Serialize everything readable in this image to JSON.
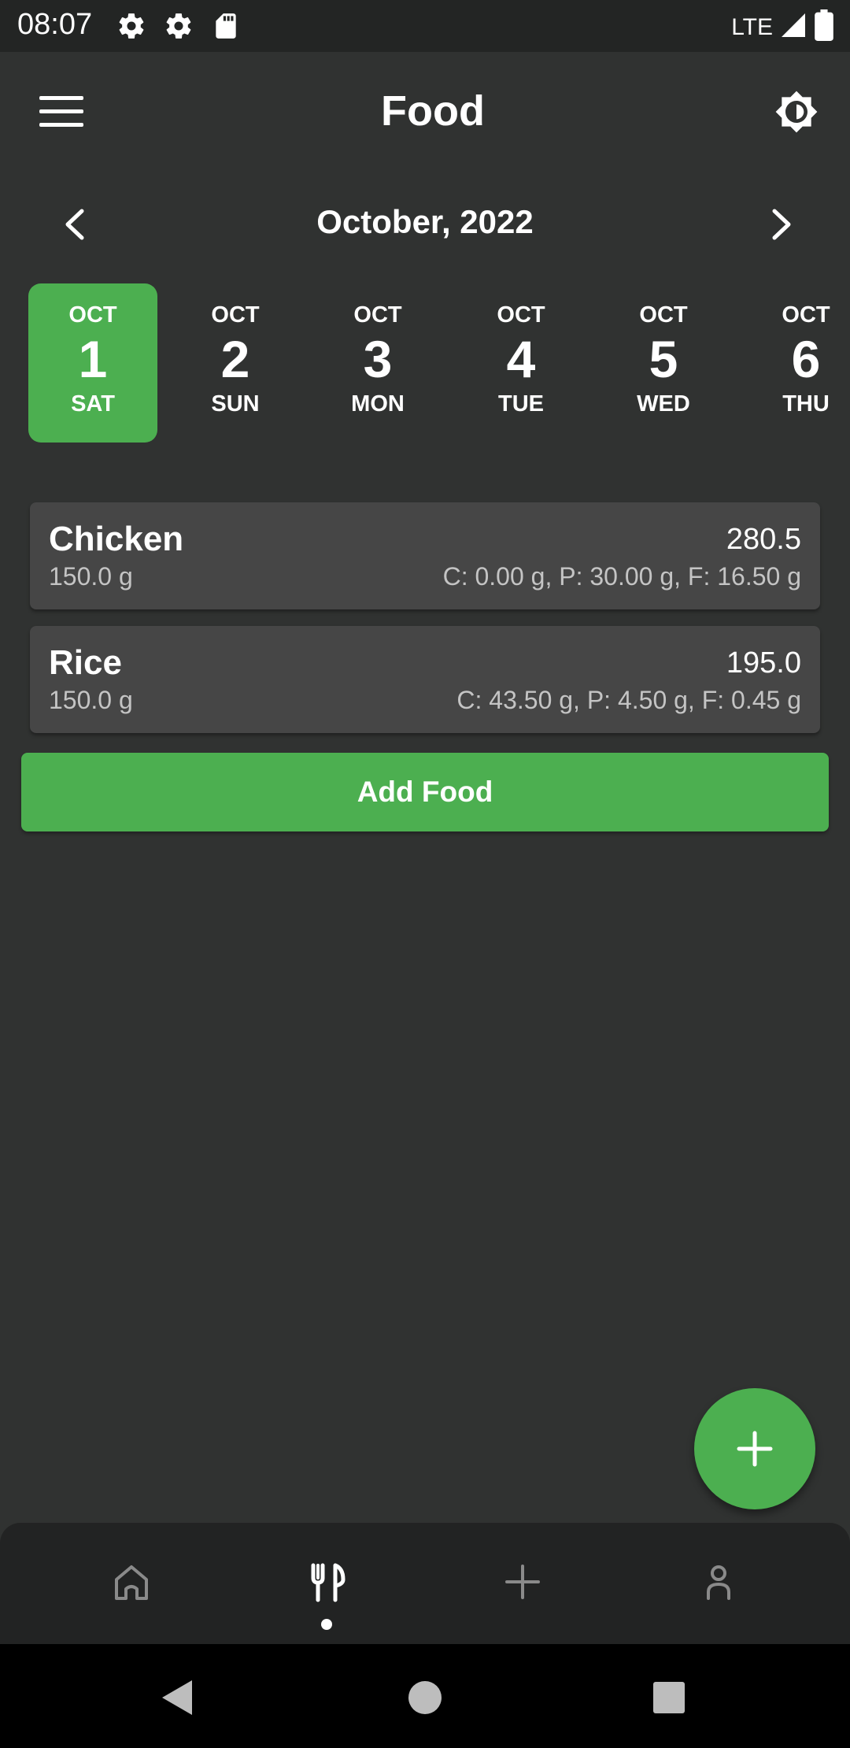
{
  "status_bar": {
    "time": "08:07",
    "network": "LTE",
    "icons": [
      "gear-icon",
      "gear-icon",
      "sd-card-icon",
      "signal-icon",
      "battery-icon"
    ]
  },
  "app_bar": {
    "title": "Food",
    "menu_icon": "hamburger-menu-icon",
    "settings_icon": "settings-brightness-icon"
  },
  "calendar": {
    "month_label": "October, 2022",
    "days": [
      {
        "month": "OCT",
        "day": "1",
        "weekday": "SAT",
        "selected": true
      },
      {
        "month": "OCT",
        "day": "2",
        "weekday": "SUN",
        "selected": false
      },
      {
        "month": "OCT",
        "day": "3",
        "weekday": "MON",
        "selected": false
      },
      {
        "month": "OCT",
        "day": "4",
        "weekday": "TUE",
        "selected": false
      },
      {
        "month": "OCT",
        "day": "5",
        "weekday": "WED",
        "selected": false
      },
      {
        "month": "OCT",
        "day": "6",
        "weekday": "THU",
        "selected": false
      }
    ]
  },
  "foods": [
    {
      "name": "Chicken",
      "weight": "150.0 g",
      "calories": "280.5",
      "macros": "C: 0.00 g, P: 30.00 g, F: 16.50 g"
    },
    {
      "name": "Rice",
      "weight": "150.0 g",
      "calories": "195.0",
      "macros": "C: 43.50 g, P: 4.50 g, F: 0.45 g"
    }
  ],
  "add_food_label": "Add Food",
  "fab_icon": "plus-icon",
  "bottom_nav": {
    "items": [
      {
        "icon": "home-icon",
        "active": false
      },
      {
        "icon": "fork-knife-icon",
        "active": true
      },
      {
        "icon": "plus-icon",
        "active": false
      },
      {
        "icon": "person-icon",
        "active": false
      }
    ]
  },
  "colors": {
    "accent": "#4caf50",
    "background": "#303231",
    "card": "#464646",
    "bottom_nav": "#222323"
  }
}
